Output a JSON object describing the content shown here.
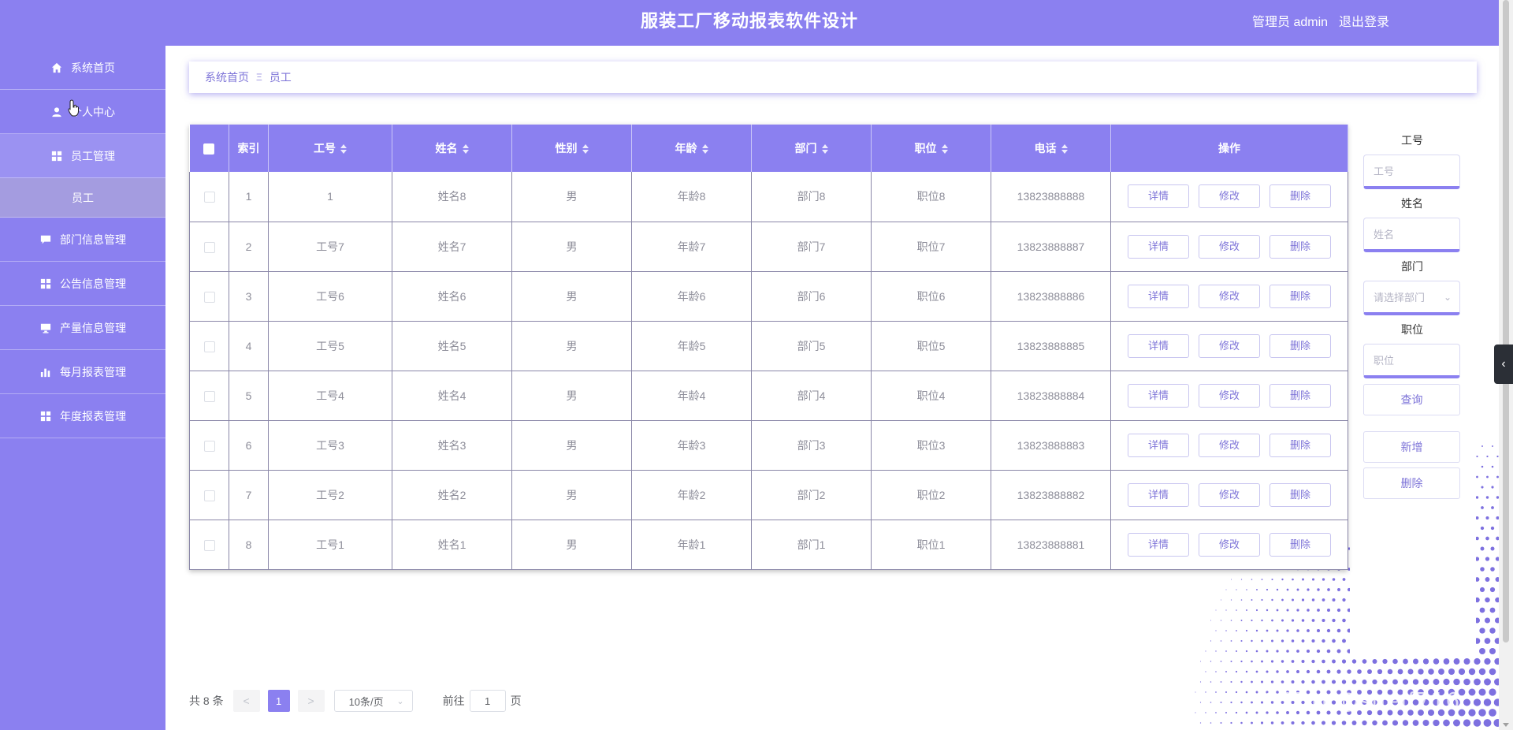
{
  "header": {
    "title": "服装工厂移动报表软件设计",
    "user": "管理员 admin",
    "logout": "退出登录"
  },
  "sidebar": {
    "items": [
      {
        "label": "系统首页",
        "icon": "home-icon"
      },
      {
        "label": "个人中心",
        "icon": "user-icon"
      },
      {
        "label": "员工管理",
        "icon": "grid-icon"
      },
      {
        "label": "员工",
        "icon": ""
      },
      {
        "label": "部门信息管理",
        "icon": "chat-icon"
      },
      {
        "label": "公告信息管理",
        "icon": "grid-icon"
      },
      {
        "label": "产量信息管理",
        "icon": "monitor-icon"
      },
      {
        "label": "每月报表管理",
        "icon": "bar-chart-icon"
      },
      {
        "label": "年度报表管理",
        "icon": "grid-icon"
      }
    ]
  },
  "breadcrumb": {
    "home": "系统首页",
    "separator": "Ξ",
    "current": "员工"
  },
  "table": {
    "headers": [
      "索引",
      "工号",
      "姓名",
      "性别",
      "年龄",
      "部门",
      "职位",
      "电话",
      "操作"
    ],
    "rows": [
      {
        "index": "1",
        "id": "1",
        "name": "姓名8",
        "gender": "男",
        "age": "年龄8",
        "dept": "部门8",
        "position": "职位8",
        "phone": "13823888888"
      },
      {
        "index": "2",
        "id": "工号7",
        "name": "姓名7",
        "gender": "男",
        "age": "年龄7",
        "dept": "部门7",
        "position": "职位7",
        "phone": "13823888887"
      },
      {
        "index": "3",
        "id": "工号6",
        "name": "姓名6",
        "gender": "男",
        "age": "年龄6",
        "dept": "部门6",
        "position": "职位6",
        "phone": "13823888886"
      },
      {
        "index": "4",
        "id": "工号5",
        "name": "姓名5",
        "gender": "男",
        "age": "年龄5",
        "dept": "部门5",
        "position": "职位5",
        "phone": "13823888885"
      },
      {
        "index": "5",
        "id": "工号4",
        "name": "姓名4",
        "gender": "男",
        "age": "年龄4",
        "dept": "部门4",
        "position": "职位4",
        "phone": "13823888884"
      },
      {
        "index": "6",
        "id": "工号3",
        "name": "姓名3",
        "gender": "男",
        "age": "年龄3",
        "dept": "部门3",
        "position": "职位3",
        "phone": "13823888883"
      },
      {
        "index": "7",
        "id": "工号2",
        "name": "姓名2",
        "gender": "男",
        "age": "年龄2",
        "dept": "部门2",
        "position": "职位2",
        "phone": "13823888882"
      },
      {
        "index": "8",
        "id": "工号1",
        "name": "姓名1",
        "gender": "男",
        "age": "年龄1",
        "dept": "部门1",
        "position": "职位1",
        "phone": "13823888881"
      }
    ],
    "actions": [
      "详情",
      "修改",
      "删除"
    ]
  },
  "search": {
    "id_label": "工号",
    "id_placeholder": "工号",
    "name_label": "姓名",
    "name_placeholder": "姓名",
    "dept_label": "部门",
    "dept_placeholder": "请选择部门",
    "position_label": "职位",
    "position_placeholder": "职位",
    "query_button": "查询",
    "add_button": "新增",
    "delete_button": "删除"
  },
  "pagination": {
    "total": "共 8 条",
    "prev": "<",
    "current_page": "1",
    "next": ">",
    "page_size": "10条/页",
    "goto_label": "前往",
    "goto_value": "1",
    "page_suffix": "页"
  },
  "watermark": "CSDN @shelf716",
  "colors": {
    "accent": "#8b80f0",
    "sidebar_active": "#9b92f2",
    "sidebar_sub": "#a49ce0",
    "link": "#7e74d8"
  }
}
